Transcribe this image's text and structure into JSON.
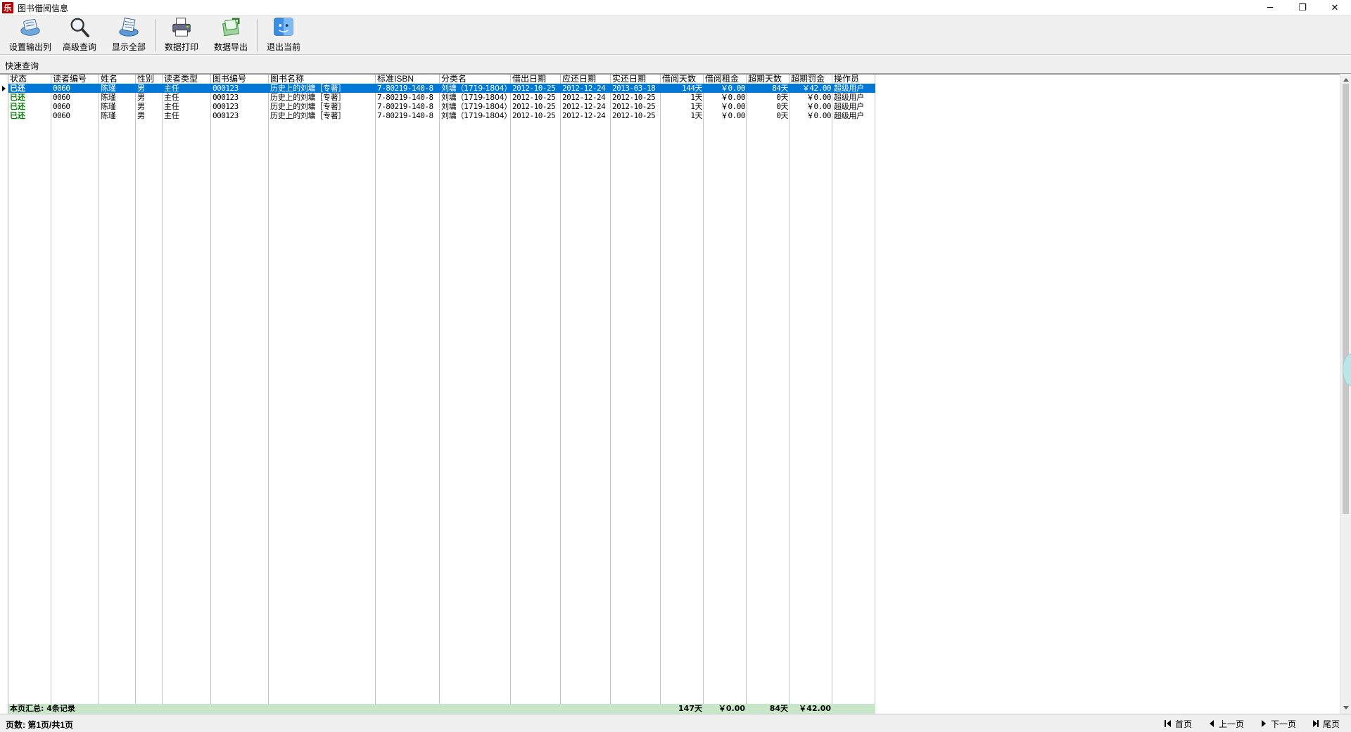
{
  "window": {
    "title": "图书借阅信息",
    "app_icon_glyph": "乐",
    "controls": {
      "minimize": "─",
      "restore": "❐",
      "close": "✕"
    }
  },
  "toolbar": {
    "buttons": [
      {
        "label": "设置输出列",
        "icon": "output-columns-icon"
      },
      {
        "label": "高级查询",
        "icon": "magnifier-icon"
      },
      {
        "label": "显示全部",
        "icon": "show-all-icon"
      },
      {
        "label": "数据打印",
        "icon": "printer-icon"
      },
      {
        "label": "数据导出",
        "icon": "export-icon"
      },
      {
        "label": "退出当前",
        "icon": "exit-icon"
      }
    ]
  },
  "quick_search": {
    "label": "快速查询"
  },
  "grid": {
    "columns": [
      "状态",
      "读者编号",
      "姓名",
      "性别",
      "读者类型",
      "图书编号",
      "图书名称",
      "标准ISBN",
      "分类名",
      "借出日期",
      "应还日期",
      "实还日期",
      "借阅天数",
      "借阅租金",
      "超期天数",
      "超期罚金",
      "操作员"
    ],
    "rows": [
      [
        "已还",
        "0060",
        "陈瑾",
        "男",
        "主任",
        "000123",
        "历史上的刘墉［专著］",
        "7-80219-140-8",
        "刘墉（1719-1804）",
        "2012-10-25",
        "2012-12-24",
        "2013-03-18",
        "144天",
        "￥0.00",
        "84天",
        "￥42.00",
        "超级用户"
      ],
      [
        "已还",
        "0060",
        "陈瑾",
        "男",
        "主任",
        "000123",
        "历史上的刘墉［专著］",
        "7-80219-140-8",
        "刘墉（1719-1804）",
        "2012-10-25",
        "2012-12-24",
        "2012-10-25",
        "1天",
        "￥0.00",
        "0天",
        "￥0.00",
        "超级用户"
      ],
      [
        "已还",
        "0060",
        "陈瑾",
        "男",
        "主任",
        "000123",
        "历史上的刘墉［专著］",
        "7-80219-140-8",
        "刘墉（1719-1804）",
        "2012-10-25",
        "2012-12-24",
        "2012-10-25",
        "1天",
        "￥0.00",
        "0天",
        "￥0.00",
        "超级用户"
      ],
      [
        "已还",
        "0060",
        "陈瑾",
        "男",
        "主任",
        "000123",
        "历史上的刘墉［专著］",
        "7-80219-140-8",
        "刘墉（1719-1804）",
        "2012-10-25",
        "2012-12-24",
        "2012-10-25",
        "1天",
        "￥0.00",
        "0天",
        "￥0.00",
        "超级用户"
      ]
    ],
    "selected_row": 0,
    "summary": {
      "label": "本页汇总: 4条记录",
      "borrow_days": "147天",
      "rent": "￥0.00",
      "overdue_days": "84天",
      "fine": "￥42.00"
    }
  },
  "status_bar": {
    "page_info": "页数: 第1页/共1页",
    "nav": {
      "first": "首页",
      "prev": "上一页",
      "next": "下一页",
      "last": "尾页"
    }
  },
  "colors": {
    "selection": "#0078d7",
    "status_returned": "#008000",
    "summary_bg": "#c8e6c8"
  }
}
